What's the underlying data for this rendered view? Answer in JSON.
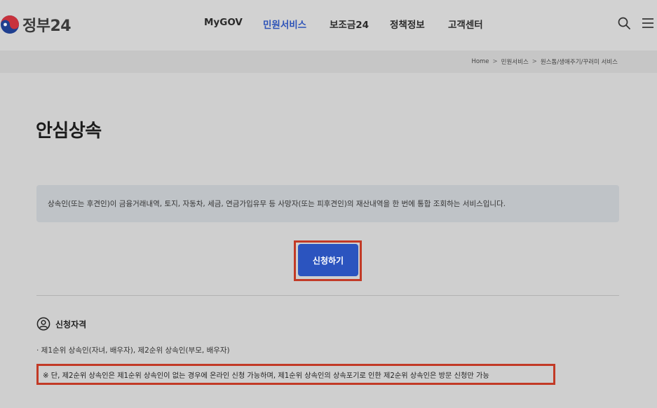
{
  "header": {
    "logo_text": "정부24",
    "nav": [
      "MyGOV",
      "민원서비스",
      "보조금24",
      "정책정보",
      "고객센터"
    ],
    "active_nav": "민원서비스",
    "icons": [
      "search-icon",
      "menu-icon"
    ]
  },
  "breadcrumb": [
    "Home",
    "민원서비스",
    "원스톱/생애주기/꾸러미 서비스"
  ],
  "main": {
    "title": "안심상속",
    "description": "상속인(또는 후견인)이 금융거래내역, 토지, 자동차, 세금, 연금가입유무 등 사망자(또는 피후견인)의 재산내역을 한 번에 통합 조회하는 서비스입니다.",
    "apply_label": "신청하기",
    "section_title": "신청자격",
    "bullet": "· 제1순위 상속인(자녀, 배우자), 제2순위 상속인(부모, 배우자)",
    "note": "※ 단, 제2순위 상속인은 제1순위 상속인이 없는 경우에 온라인 신청 가능하며, 제1순위 상속인의 상속포기로 인한 제2순위 상속인은 방문 신청만 가능"
  },
  "colors": {
    "accent": "#2b54bf",
    "highlight": "#c23a26",
    "active_nav": "#2d53b8"
  }
}
